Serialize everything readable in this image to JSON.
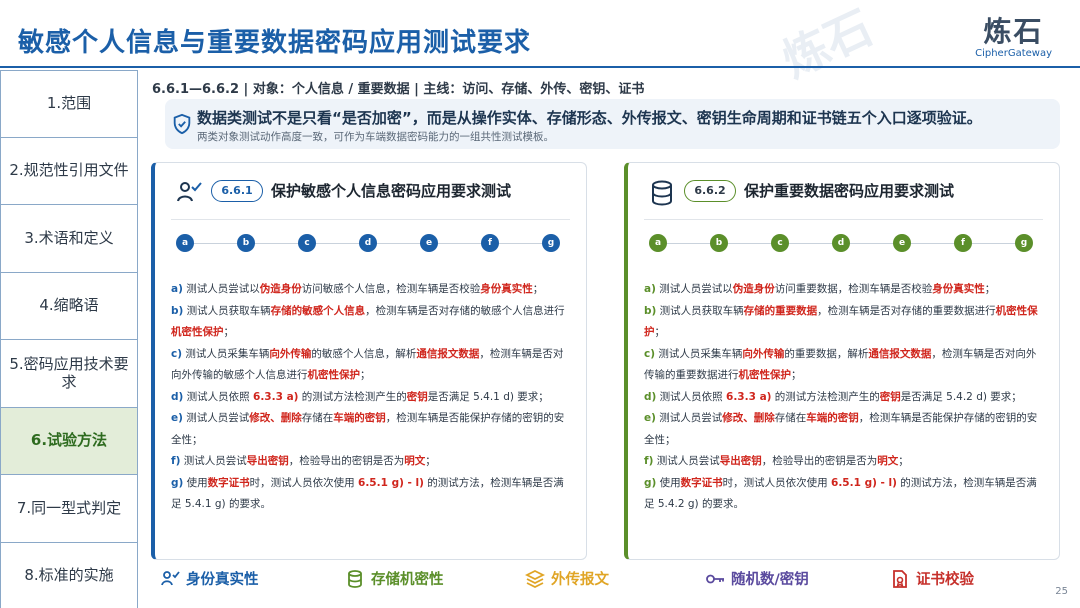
{
  "header": {
    "title": "敏感个人信息与重要数据密码应用测试要求",
    "logo_cn": "炼石",
    "logo_en": "CipherGateway",
    "watermark": "炼石"
  },
  "sidebar": {
    "items": [
      {
        "label": "1.范围"
      },
      {
        "label": "2.规范性引用文件"
      },
      {
        "label": "3.术语和定义"
      },
      {
        "label": "4.缩略语"
      },
      {
        "label": "5.密码应用技术要求"
      },
      {
        "label": "6.试验方法"
      },
      {
        "label": "7.同一型式判定"
      },
      {
        "label": "8.标准的实施"
      }
    ]
  },
  "subhead": "6.6.1—6.6.2 | 对象：个人信息 / 重要数据 | 主线：访问、存储、外传、密钥、证书",
  "banner": {
    "main": "数据类测试不是只看“是否加密”，而是从操作实体、存储形态、外传报文、密钥生命周期和证书链五个入口逐项验证。",
    "sub": "两类对象测试动作高度一致，可作为车端数据密码能力的一组共性测试模板。"
  },
  "left_panel": {
    "badge": "6.6.1",
    "title": "保护敏感个人信息密码应用要求测试",
    "timeline": [
      "a",
      "b",
      "c",
      "d",
      "e",
      "f",
      "g"
    ],
    "items": [
      {
        "label": "a)",
        "p1": "测试人员尝试以",
        "h1": "伪造身份",
        "p2": "访问敏感个人信息，检测车辆是否校验",
        "h2": "身份真实性",
        "p3": "；",
        "h3": "",
        "p4": ""
      },
      {
        "label": "b)",
        "p1": "测试人员获取车辆",
        "h1": "存储的敏感个人信息",
        "p2": "，检测车辆是否对存储的敏感个人信息进行",
        "h2": "机密性保护",
        "p3": "；",
        "h3": "",
        "p4": ""
      },
      {
        "label": "c)",
        "p1": "测试人员采集车辆",
        "h1": "向外传输",
        "p2": "的敏感个人信息，解析",
        "h2": "通信报文数据",
        "p3": "，检测车辆是否对向外传输的敏感个人信息进行",
        "h3": "机密性保护",
        "p4": "；"
      },
      {
        "label": "d)",
        "p1": "测试人员依照 ",
        "h1": "6.3.3 a)",
        "p2": " 的测试方法检测产生的",
        "h2": "密钥",
        "p3": "是否满足 5.4.1 d) 要求；",
        "h3": "",
        "p4": ""
      },
      {
        "label": "e)",
        "p1": "测试人员尝试",
        "h1": "修改、删除",
        "p2": "存储在",
        "h2": "车端的密钥",
        "p3": "，检测车辆是否能保护存储的密钥的安全性；",
        "h3": "",
        "p4": ""
      },
      {
        "label": "f)",
        "p1": "测试人员尝试",
        "h1": "导出密钥",
        "p2": "，检验导出的密钥是否为",
        "h2": "明文",
        "p3": "；",
        "h3": "",
        "p4": ""
      },
      {
        "label": "g)",
        "p1": "使用",
        "h1": "数字证书",
        "p2": "时，测试人员依次使用 ",
        "h2": "6.5.1 g) - l)",
        "p3": " 的测试方法，检测车辆是否满足 5.4.1 g) 的要求。",
        "h3": "",
        "p4": ""
      }
    ]
  },
  "right_panel": {
    "badge": "6.6.2",
    "title": "保护重要数据密码应用要求测试",
    "timeline": [
      "a",
      "b",
      "c",
      "d",
      "e",
      "f",
      "g"
    ],
    "items": [
      {
        "label": "a)",
        "p1": "测试人员尝试以",
        "h1": "伪造身份",
        "p2": "访问重要数据，检测车辆是否校验",
        "h2": "身份真实性",
        "p3": "；",
        "h3": "",
        "p4": ""
      },
      {
        "label": "b)",
        "p1": "测试人员获取车辆",
        "h1": "存储的重要数据",
        "p2": "，检测车辆是否对存储的重要数据进行",
        "h2": "机密性保护",
        "p3": "；",
        "h3": "",
        "p4": ""
      },
      {
        "label": "c)",
        "p1": "测试人员采集车辆",
        "h1": "向外传输",
        "p2": "的重要数据，解析",
        "h2": "通信报文数据",
        "p3": "，检测车辆是否对向外传输的重要数据进行",
        "h3": "机密性保护",
        "p4": "；"
      },
      {
        "label": "d)",
        "p1": "测试人员依照 ",
        "h1": "6.3.3 a)",
        "p2": " 的测试方法检测产生的",
        "h2": "密钥",
        "p3": "是否满足 5.4.2 d) 要求；",
        "h3": "",
        "p4": ""
      },
      {
        "label": "e)",
        "p1": "测试人员尝试",
        "h1": "修改、删除",
        "p2": "存储在",
        "h2": "车端的密钥",
        "p3": "，检测车辆是否能保护存储的密钥的安全性；",
        "h3": "",
        "p4": ""
      },
      {
        "label": "f)",
        "p1": "测试人员尝试",
        "h1": "导出密钥",
        "p2": "，检验导出的密钥是否为",
        "h2": "明文",
        "p3": "；",
        "h3": "",
        "p4": ""
      },
      {
        "label": "g)",
        "p1": "使用",
        "h1": "数字证书",
        "p2": "时，测试人员依次使用 ",
        "h2": "6.5.1 g) - l)",
        "p3": " 的测试方法，检测车辆是否满足 5.4.2 g) 的要求。",
        "h3": "",
        "p4": ""
      }
    ]
  },
  "bottom": {
    "items": [
      {
        "label": "身份真实性",
        "icon": "user-check-icon",
        "color": "#1b5fa8"
      },
      {
        "label": "存储机密性",
        "icon": "database-icon",
        "color": "#5b8f2a"
      },
      {
        "label": "外传报文",
        "icon": "layers-icon",
        "color": "#e0a526"
      },
      {
        "label": "随机数/密钥",
        "icon": "key-icon",
        "color": "#5a4a9e"
      },
      {
        "label": "证书校验",
        "icon": "certificate-icon",
        "color": "#c6302b"
      }
    ]
  },
  "page_number": "25"
}
